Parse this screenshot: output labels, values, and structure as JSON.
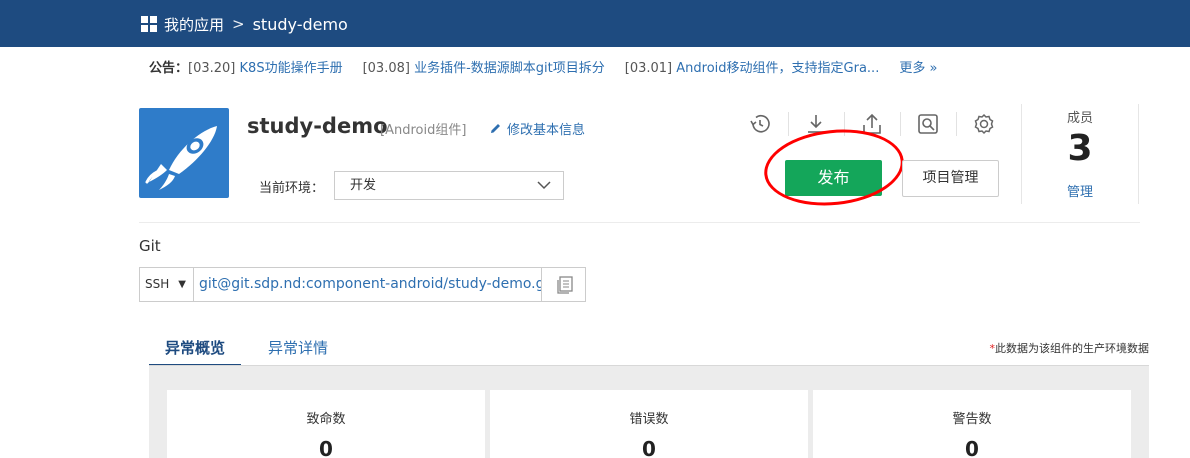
{
  "nav": {
    "my_apps": "我的应用",
    "separator": ">",
    "current": "study-demo"
  },
  "notice": {
    "label": "公告：",
    "items": [
      {
        "date": "[03.20]",
        "text": "K8S功能操作手册"
      },
      {
        "date": "[03.08]",
        "text": "业务插件-数据源脚本git项目拆分"
      },
      {
        "date": "[03.01]",
        "text": "Android移动组件，支持指定Gra..."
      }
    ],
    "more": "更多 »"
  },
  "project": {
    "name": "study-demo",
    "type": "[Android组件]",
    "edit_label": "修改基本信息",
    "env_label": "当前环境：",
    "env_value": "开发"
  },
  "actions": {
    "tools": [
      "history-icon",
      "download-icon",
      "upload-icon",
      "inspect-icon",
      "settings-icon"
    ],
    "publish": "发布",
    "manage": "项目管理"
  },
  "members": {
    "title": "成员",
    "count": "3",
    "link": "管理"
  },
  "git": {
    "label": "Git",
    "protocol": "SSH",
    "url": "git@git.sdp.nd:component-android/study-demo.git"
  },
  "tabs": [
    {
      "label": "异常概览",
      "active": true
    },
    {
      "label": "异常详情",
      "active": false
    }
  ],
  "data_note": "此数据为该组件的生产环境数据",
  "stats": [
    {
      "title": "致命数",
      "value": "0"
    },
    {
      "title": "错误数",
      "value": "0"
    },
    {
      "title": "警告数",
      "value": "0"
    }
  ],
  "colors": {
    "nav_bg": "#1e4b80",
    "publish": "#14a65a",
    "link": "#2e6fb0",
    "highlight": "#ff0000"
  }
}
